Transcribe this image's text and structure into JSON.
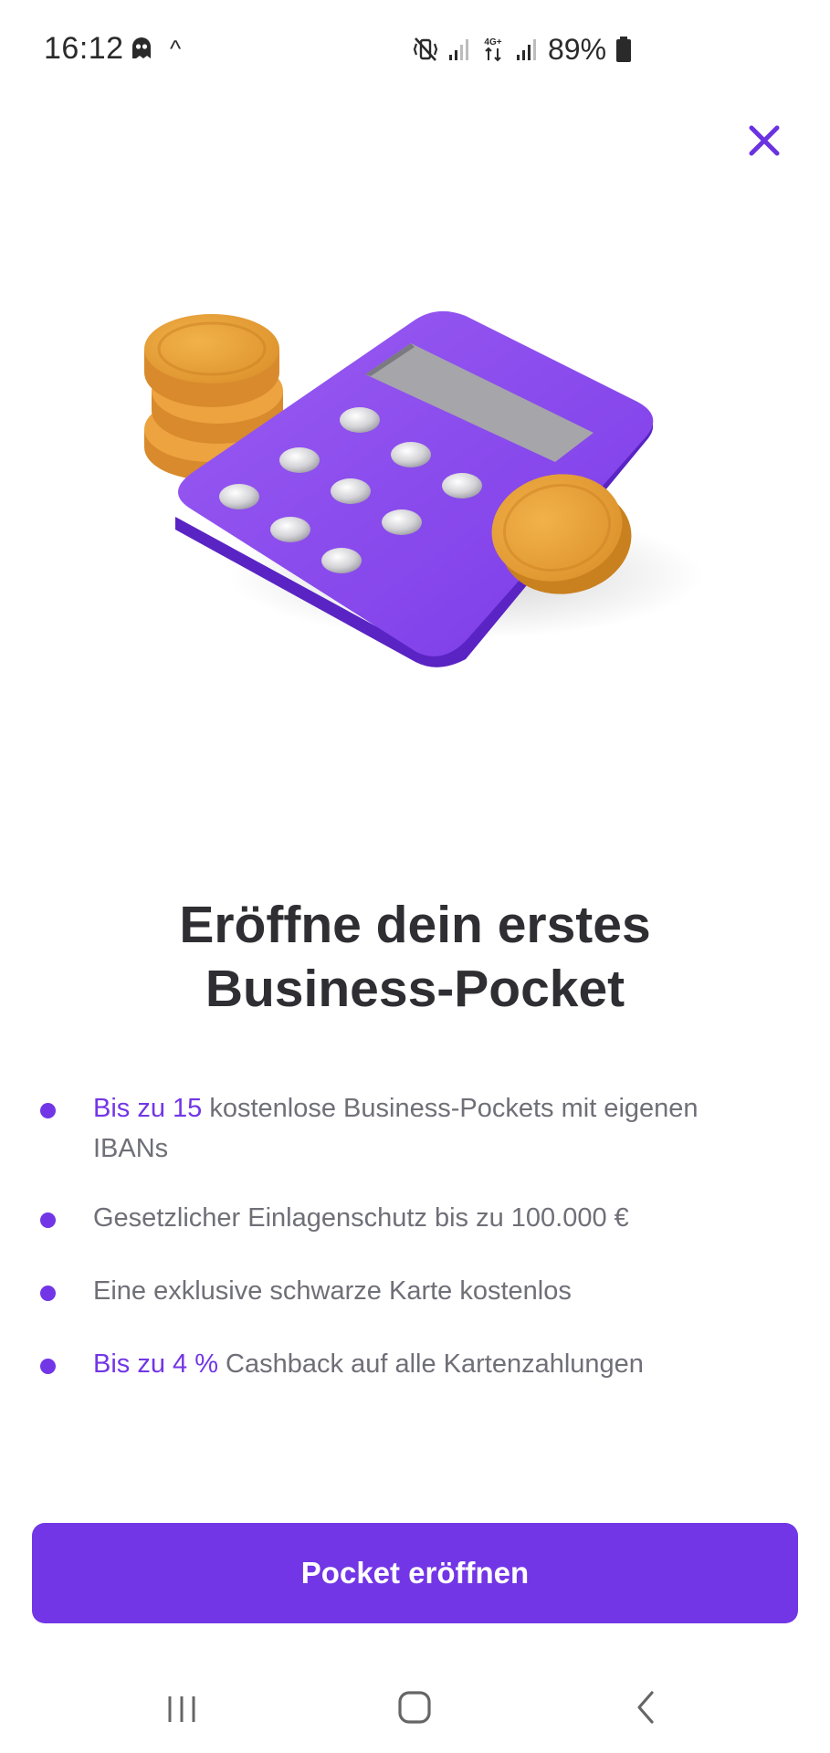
{
  "status_bar": {
    "time": "16:12",
    "battery": "89%",
    "network_label": "4G+",
    "icons": [
      "ghost-icon",
      "caret-up-icon",
      "mute-vibrate-icon",
      "signal-icon",
      "data-4g-icon",
      "signal-icon",
      "battery-icon"
    ]
  },
  "close": {
    "icon": "close-icon"
  },
  "illustration": {
    "icon": "calculator-with-coins-illustration"
  },
  "title": {
    "line1": "Eröffne dein erstes",
    "line2": "Business-Pocket"
  },
  "benefits": [
    {
      "highlight": "Bis zu 15",
      "text": " kostenlose Business-Pockets mit eigenen IBANs"
    },
    {
      "highlight": "",
      "text": "Gesetzlicher Einlagenschutz bis zu 100.000 €"
    },
    {
      "highlight": "",
      "text": "Eine exklusive schwarze Karte kostenlos"
    },
    {
      "highlight": "Bis zu 4 %",
      "text": " Cashback auf alle Kartenzahlungen"
    }
  ],
  "cta": {
    "label": "Pocket eröffnen"
  },
  "nav_bar": {
    "icons": [
      "recents-icon",
      "home-icon",
      "back-icon"
    ]
  },
  "colors": {
    "accent": "#7236e6",
    "text_dark": "#2e2e33",
    "text_muted": "#6f6f78",
    "coin": "#e7a23c"
  }
}
